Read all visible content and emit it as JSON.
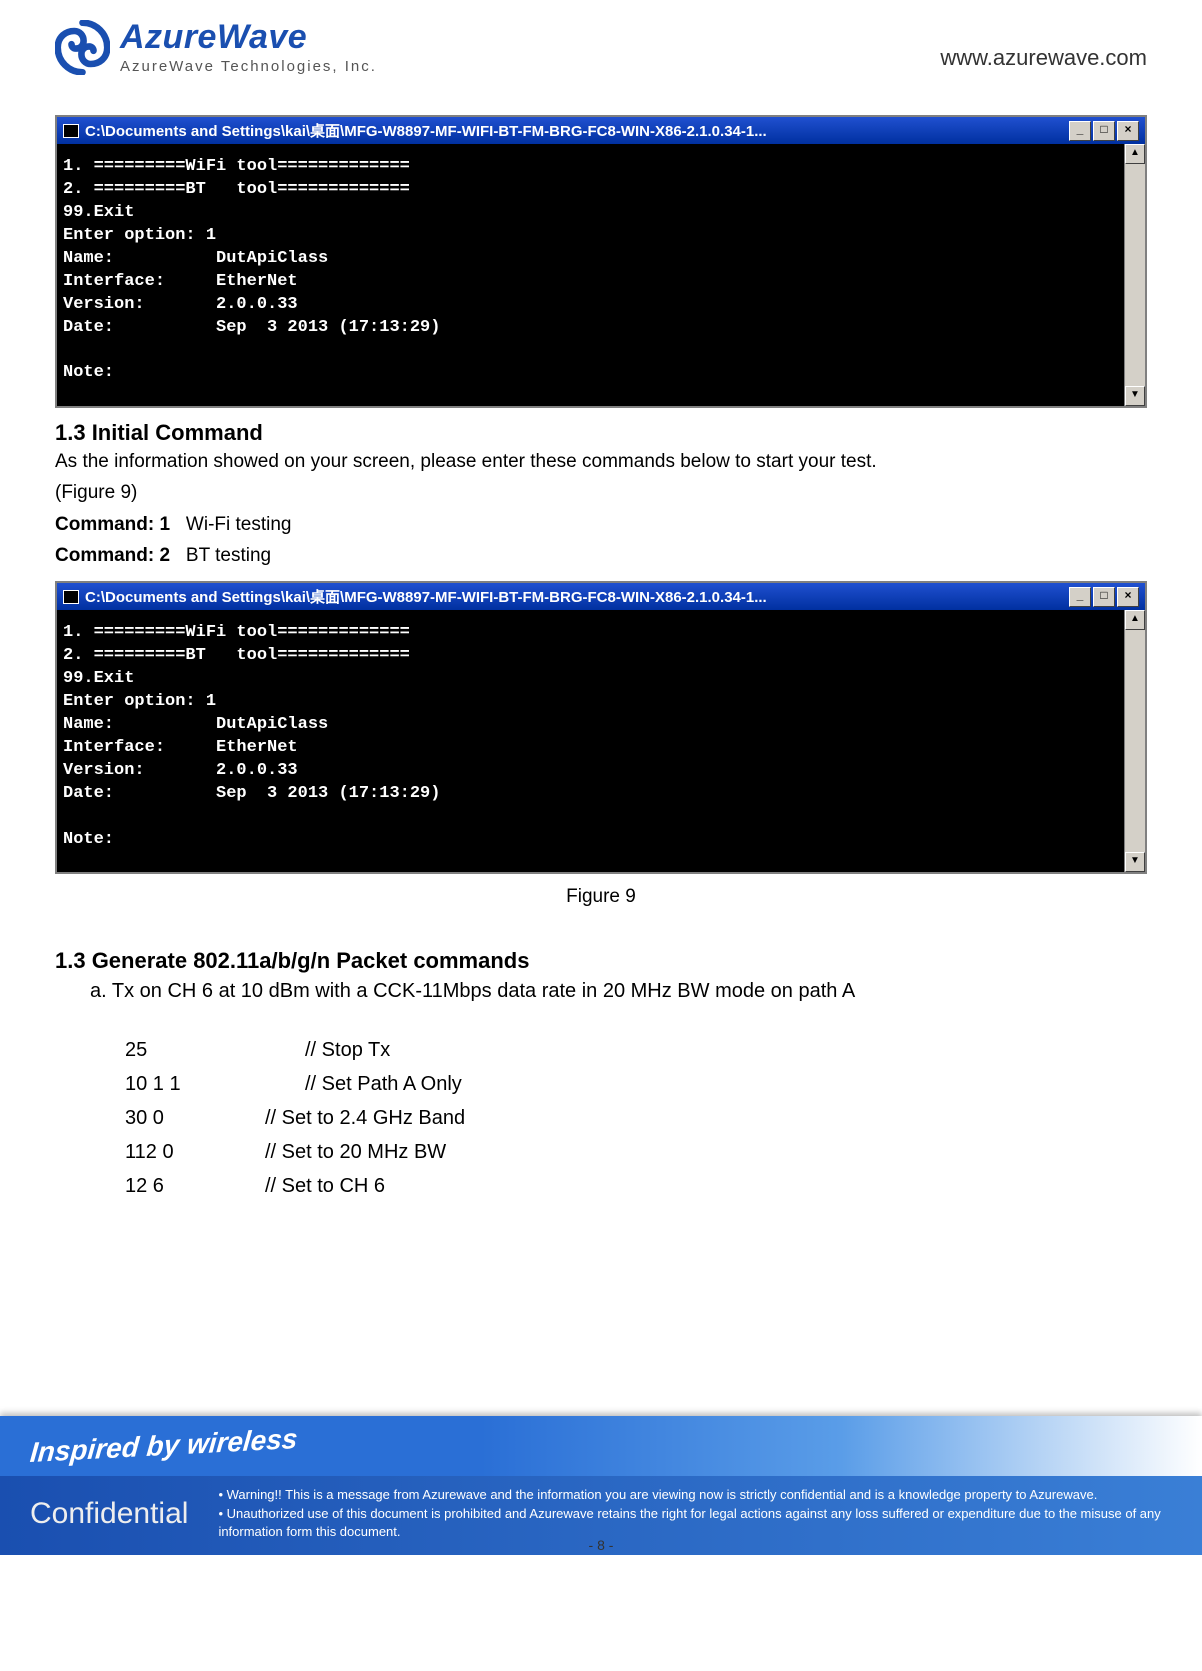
{
  "header": {
    "logo_main": "AzureWave",
    "logo_sub": "AzureWave  Technologies,  Inc.",
    "site_url": "www.azurewave.com"
  },
  "terminal": {
    "title": "C:\\Documents and Settings\\kai\\桌面\\MFG-W8897-MF-WIFI-BT-FM-BRG-FC8-WIN-X86-2.1.0.34-1...",
    "min": "_",
    "max": "□",
    "close": "×",
    "up": "▲",
    "down": "▼",
    "content": "1. =========WiFi tool=============\n2. =========BT   tool=============\n99.Exit\nEnter option: 1\nName:          DutApiClass\nInterface:     EtherNet\nVersion:       2.0.0.33\nDate:          Sep  3 2013 (17:13:29)\n\nNote:"
  },
  "section1": {
    "title": "1.3 Initial Command",
    "p1": "As the information showed on your screen, please enter these commands below to start your test.",
    "p2": "(Figure 9)",
    "c1_label": "Command: 1",
    "c1_desc": "Wi-Fi testing",
    "c2_label": "Command: 2",
    "c2_desc": "BT testing",
    "caption": "Figure 9"
  },
  "section2": {
    "title": "1.3 Generate 802.11a/b/g/n Packet commands",
    "sub_a": "a. Tx on CH 6 at 10 dBm with a CCK-11Mbps data rate in 20 MHz BW mode on path A",
    "rows": [
      {
        "code": "25",
        "comment": "// Stop Tx",
        "wide": true
      },
      {
        "code": "10 1 1",
        "comment": "// Set Path A Only",
        "wide": true
      },
      {
        "code": "30 0",
        "comment": "// Set to 2.4 GHz Band"
      },
      {
        "code": "112 0",
        "comment": "// Set to 20 MHz BW"
      },
      {
        "code": "12 6",
        "comment": "// Set to CH 6"
      }
    ]
  },
  "footer": {
    "inspired": "Inspired by wireless",
    "confidential": "Confidential",
    "w1": "Warning!! This is a message from Azurewave and the information you are viewing now is strictly confidential and is a knowledge property to Azurewave.",
    "w2": "Unauthorized use of this document is prohibited and Azurewave retains the right for legal actions against any loss suffered or expenditure due to the misuse of any information form this document.",
    "page_num": "- 8 -"
  }
}
